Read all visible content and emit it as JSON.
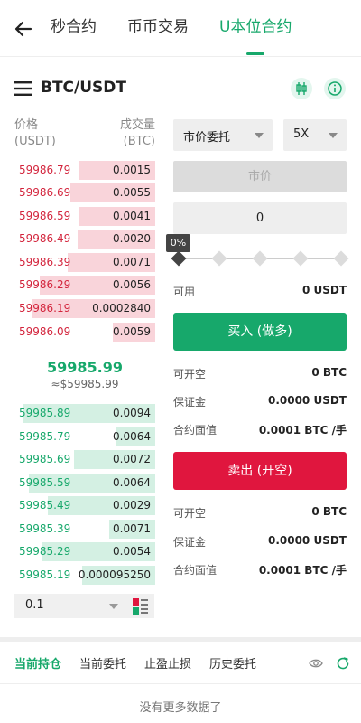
{
  "nav": {
    "tabs": [
      {
        "label": "秒合约"
      },
      {
        "label": "币币交易"
      },
      {
        "label": "U本位合约"
      }
    ]
  },
  "symbol": {
    "pair": "BTC/USDT"
  },
  "orderbook": {
    "header": {
      "price": "价格",
      "price_unit": "(USDT)",
      "volume": "成交量",
      "volume_unit": "(BTC)"
    },
    "asks": [
      {
        "price": "59986.79",
        "qty": "0.0015",
        "depth": 0.54
      },
      {
        "price": "59986.69",
        "qty": "0.0055",
        "depth": 0.6
      },
      {
        "price": "59986.59",
        "qty": "0.0041",
        "depth": 0.54
      },
      {
        "price": "59986.49",
        "qty": "0.0020",
        "depth": 0.55
      },
      {
        "price": "59986.39",
        "qty": "0.0071",
        "depth": 0.62
      },
      {
        "price": "59986.29",
        "qty": "0.0056",
        "depth": 0.82
      },
      {
        "price": "59986.19",
        "qty": "0.0002840",
        "depth": 0.88
      },
      {
        "price": "59986.09",
        "qty": "0.0059",
        "depth": 0.3
      }
    ],
    "last_price": "59985.99",
    "last_usd": "≈$59985.99",
    "bids": [
      {
        "price": "59985.89",
        "qty": "0.0094",
        "depth": 0.94
      },
      {
        "price": "59985.79",
        "qty": "0.0064",
        "depth": 0.28
      },
      {
        "price": "59985.69",
        "qty": "0.0072",
        "depth": 0.58
      },
      {
        "price": "59985.59",
        "qty": "0.0064",
        "depth": 0.9
      },
      {
        "price": "59985.49",
        "qty": "0.0029",
        "depth": 0.76
      },
      {
        "price": "59985.39",
        "qty": "0.0071",
        "depth": 0.33
      },
      {
        "price": "59985.29",
        "qty": "0.0054",
        "depth": 0.81
      },
      {
        "price": "59985.19",
        "qty": "0.000095250",
        "depth": 0.52
      }
    ],
    "depth_select": "0.1"
  },
  "form": {
    "order_type": "市价委托",
    "leverage": "5X",
    "price_placeholder": "市价",
    "amount": "0",
    "percent": "0%",
    "percent_value": 0,
    "available_label": "可用",
    "available_value": "0 USDT",
    "buy_label": "买入 (做多)",
    "buy_info": [
      {
        "k": "可开空",
        "v": "0 BTC"
      },
      {
        "k": "保证金",
        "v": "0.0000 USDT"
      },
      {
        "k": "合约面值",
        "v": "0.0001 BTC /手"
      }
    ],
    "sell_label": "卖出 (开空)",
    "sell_info": [
      {
        "k": "可开空",
        "v": "0 BTC"
      },
      {
        "k": "保证金",
        "v": "0.0000 USDT"
      },
      {
        "k": "合约面值",
        "v": "0.0001 BTC /手"
      }
    ]
  },
  "bottom": {
    "tabs": [
      {
        "label": "当前持仓"
      },
      {
        "label": "当前委托"
      },
      {
        "label": "止盈止损"
      },
      {
        "label": "历史委托"
      }
    ],
    "empty_text": "没有更多数据了"
  },
  "colors": {
    "up": "#17a86b",
    "down": "#e0163e"
  }
}
